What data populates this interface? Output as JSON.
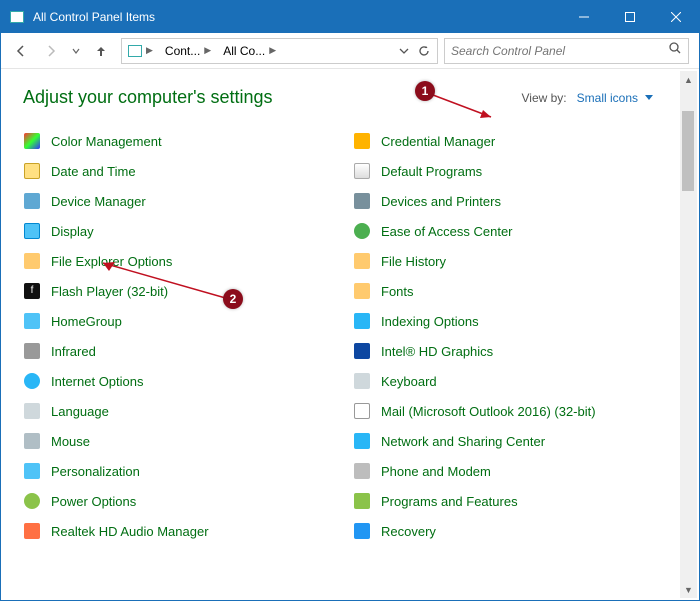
{
  "window": {
    "title": "All Control Panel Items"
  },
  "breadcrumb": {
    "part1": "Cont...",
    "part2": "All Co..."
  },
  "search": {
    "placeholder": "Search Control Panel"
  },
  "headings": {
    "main": "Adjust your computer's settings",
    "viewby_label": "View by:",
    "viewby_value": "Small icons"
  },
  "left_items": [
    "Color Management",
    "Date and Time",
    "Device Manager",
    "Display",
    "File Explorer Options",
    "Flash Player (32-bit)",
    "HomeGroup",
    "Infrared",
    "Internet Options",
    "Language",
    "Mouse",
    "Personalization",
    "Power Options",
    "Realtek HD Audio Manager"
  ],
  "right_items": [
    "Credential Manager",
    "Default Programs",
    "Devices and Printers",
    "Ease of Access Center",
    "File History",
    "Fonts",
    "Indexing Options",
    "Intel® HD Graphics",
    "Keyboard",
    "Mail (Microsoft Outlook 2016) (32-bit)",
    "Network and Sharing Center",
    "Phone and Modem",
    "Programs and Features",
    "Recovery"
  ],
  "annotations": {
    "callout1": "1",
    "callout2": "2"
  }
}
